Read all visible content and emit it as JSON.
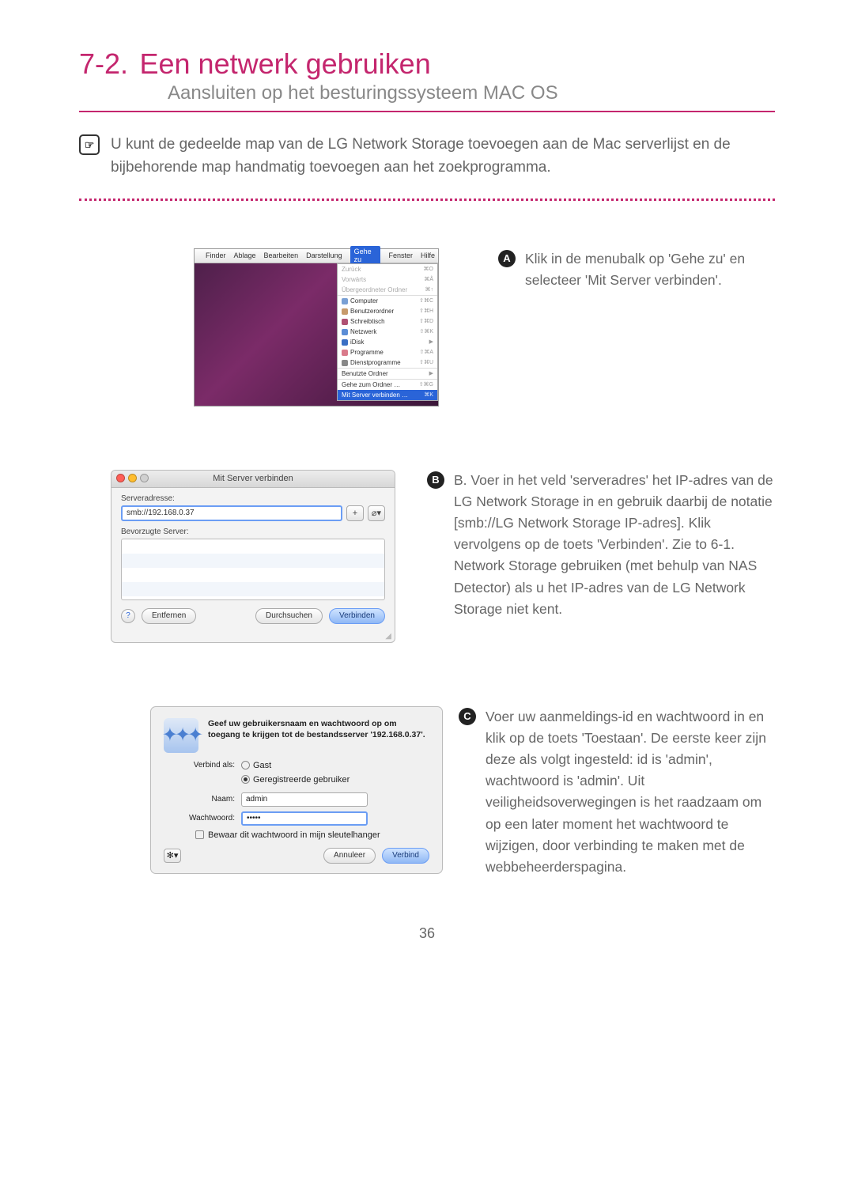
{
  "heading": {
    "number": "7-2.",
    "title": "Een netwerk gebruiken",
    "subtitle": "Aansluiten op het besturingssysteem MAC OS"
  },
  "intro": "U kunt de gedeelde map van de LG Network Storage toevoegen aan de Mac serverlijst en de bijbehorende map handmatig toevoegen aan het zoekprogramma.",
  "stepA": {
    "badge": "A",
    "text": "Klik in de menubalk op 'Gehe zu' en selecteer 'Mit Server verbinden'.",
    "menubar": [
      "Finder",
      "Ablage",
      "Bearbeiten",
      "Darstellung",
      "Gehe zu",
      "Fenster",
      "Hilfe"
    ],
    "dropdown": [
      {
        "label": "Zurück",
        "sc": "⌘O",
        "disabled": true
      },
      {
        "label": "Vorwärts",
        "sc": "⌘Å",
        "disabled": true
      },
      {
        "label": "Übergeordneter Ordner",
        "sc": "⌘↑",
        "disabled": true
      },
      {
        "sep": true
      },
      {
        "label": "Computer",
        "sc": "⇧⌘C",
        "icon": "#7aa0d4"
      },
      {
        "label": "Benutzerordner",
        "sc": "⇧⌘H",
        "icon": "#c79a6b"
      },
      {
        "label": "Schreibtisch",
        "sc": "⇧⌘D",
        "icon": "#b05173"
      },
      {
        "label": "Netzwerk",
        "sc": "⇧⌘K",
        "icon": "#5b8dd6"
      },
      {
        "label": "iDisk",
        "sc": "▶",
        "icon": "#3a6fc4"
      },
      {
        "label": "Programme",
        "sc": "⇧⌘A",
        "icon": "#d97a8a"
      },
      {
        "label": "Dienstprogramme",
        "sc": "⇧⌘U",
        "icon": "#888"
      },
      {
        "sep": true
      },
      {
        "label": "Benutzte Ordner",
        "sc": "▶"
      },
      {
        "sep": true
      },
      {
        "label": "Gehe zum Ordner …",
        "sc": "⇧⌘G"
      },
      {
        "label": "Mit Server verbinden …",
        "sc": "⌘K",
        "selected": true
      }
    ]
  },
  "stepB": {
    "badge": "B",
    "text": "B. Voer in het veld 'serveradres' het IP-adres van de LG Network Storage in en gebruik daarbij de notatie [smb://LG Network Storage IP-adres]. Klik vervolgens op de toets 'Verbinden'. Zie to 6-1. Network Storage gebruiken (met behulp van NAS Detector) als u het IP-adres van de LG Network Storage niet kent.",
    "dialog": {
      "title": "Mit Server verbinden",
      "addrLabel": "Serveradresse:",
      "address": "smb://192.168.0.37",
      "plus": "+",
      "history": "⌀▾",
      "favLabel": "Bevorzugte Server:",
      "help": "?",
      "remove": "Entfernen",
      "browse": "Durchsuchen",
      "connect": "Verbinden"
    }
  },
  "stepC": {
    "badge": "C",
    "text": "Voer uw aanmeldings-id en wachtwoord in en klik op de toets 'Toestaan'. De eerste keer zijn deze als volgt ingesteld: id is 'admin', wachtwoord is 'admin'. Uit veiligheidsoverwegingen is het raadzaam om op een later moment het wachtwoord te wijzigen, door verbinding te maken met de webbeheerderspagina.",
    "dialog": {
      "message": "Geef uw gebruikersnaam en wachtwoord op om toegang te krijgen tot de bestandsserver '192.168.0.37'.",
      "connectAs": "Verbind als:",
      "guest": "Gast",
      "registered": "Geregistreerde gebruiker",
      "nameLabel": "Naam:",
      "nameValue": "admin",
      "pwLabel": "Wachtwoord:",
      "pwValue": "•••••",
      "remember": "Bewaar dit wachtwoord in mijn sleutelhanger",
      "gear": "✻▾",
      "cancel": "Annuleer",
      "ok": "Verbind"
    }
  },
  "pageNumber": "36"
}
